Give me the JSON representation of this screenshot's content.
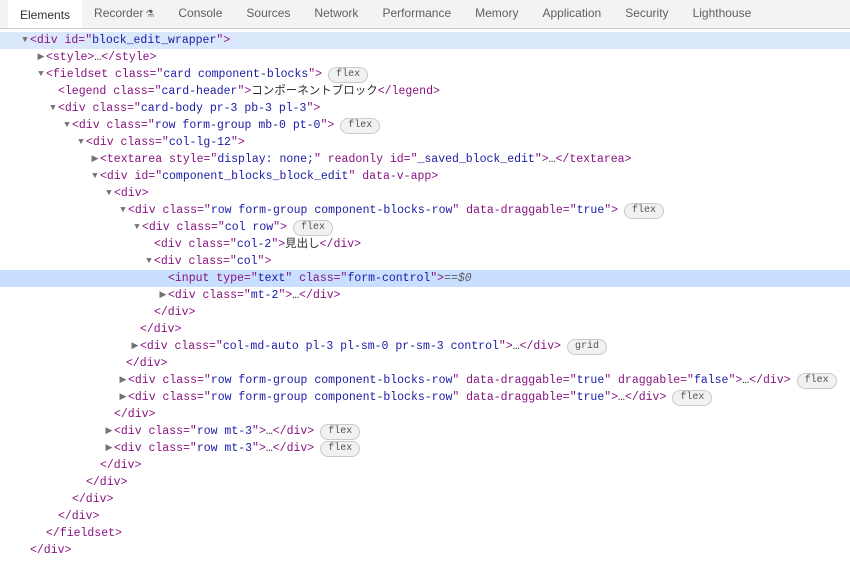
{
  "tabs": {
    "elements": "Elements",
    "recorder": "Recorder",
    "console": "Console",
    "sources": "Sources",
    "network": "Network",
    "performance": "Performance",
    "memory": "Memory",
    "application": "Application",
    "security": "Security",
    "lighthouse": "Lighthouse"
  },
  "badges": {
    "flex": "flex",
    "grid": "grid"
  },
  "tree": {
    "e": "…",
    "eq": " == ",
    "var0": "$0",
    "div_open": "<div>",
    "div_close": "</div>",
    "fieldset_close": "</fieldset>",
    "wrapper": {
      "open": "<div id=\"",
      "id": "block_edit_wrapper",
      "close": "\">"
    },
    "style": {
      "open": "<style>",
      "close": "</style>"
    },
    "fieldset": {
      "open": "<fieldset class=\"",
      "cls": "card component-blocks",
      "close": "\">"
    },
    "legend": {
      "open": "<legend class=\"",
      "cls": "card-header",
      "mid": "\">",
      "text": "コンポーネントブロック",
      "close": "</legend>"
    },
    "cardbody": {
      "open": "<div class=\"",
      "cls": "card-body pr-3 pb-3 pl-3",
      "close": "\">"
    },
    "rowfg": {
      "open": "<div class=\"",
      "cls": "row form-group mb-0 pt-0",
      "close": "\">"
    },
    "collg": {
      "open": "<div class=\"",
      "cls": "col-lg-12",
      "close": "\">"
    },
    "textarea": {
      "open": "<textarea style=\"",
      "style": "display: none;",
      "mid1": "\" readonly id=\"",
      "id": "_saved_block_edit",
      "mid2": "\">",
      "close": "</textarea>"
    },
    "vapp": {
      "open": "<div id=\"",
      "id": "component_blocks_block_edit",
      "mid": "\" data-v-app>",
      "close": ""
    },
    "cbrow": {
      "open": "<div class=\"",
      "cls": "row form-group component-blocks-row",
      "mid": "\" data-draggable=\"",
      "val": "true",
      "close": "\">"
    },
    "colrow": {
      "open": "<div class=\"",
      "cls": "col row",
      "close": "\">"
    },
    "col2": {
      "open": "<div class=\"",
      "cls": "col-2",
      "mid": "\">",
      "text": "見出し",
      "close": "</div>"
    },
    "col": {
      "open": "<div class=\"",
      "cls": "col",
      "close": "\">"
    },
    "input": {
      "open": "<input type=\"",
      "type": "text",
      "mid": "\" class=\"",
      "cls": "form-control",
      "close": "\">"
    },
    "mt2": {
      "open": "<div class=\"",
      "cls": "mt-2",
      "close": "\">"
    },
    "ctrl": {
      "open": "<div class=\"",
      "cls": "col-md-auto pl-3 pl-sm-0 pr-sm-3 control",
      "close": "\">"
    },
    "cbrow2": {
      "open": "<div class=\"",
      "cls": "row form-group component-blocks-row",
      "mid": "\" data-draggable=\"",
      "v1": "true",
      "mid2": "\" draggable=\"",
      "v2": "false",
      "close": "\">"
    },
    "cbrow3": {
      "open": "<div class=\"",
      "cls": "row form-group component-blocks-row",
      "mid": "\" data-draggable=\"",
      "val": "true",
      "close": "\">"
    },
    "rowmt3a": {
      "open": "<div class=\"",
      "cls": "row mt-3",
      "close": "\">"
    },
    "rowmt3b": {
      "open": "<div class=\"",
      "cls": "row mt-3",
      "close": "\">"
    }
  }
}
